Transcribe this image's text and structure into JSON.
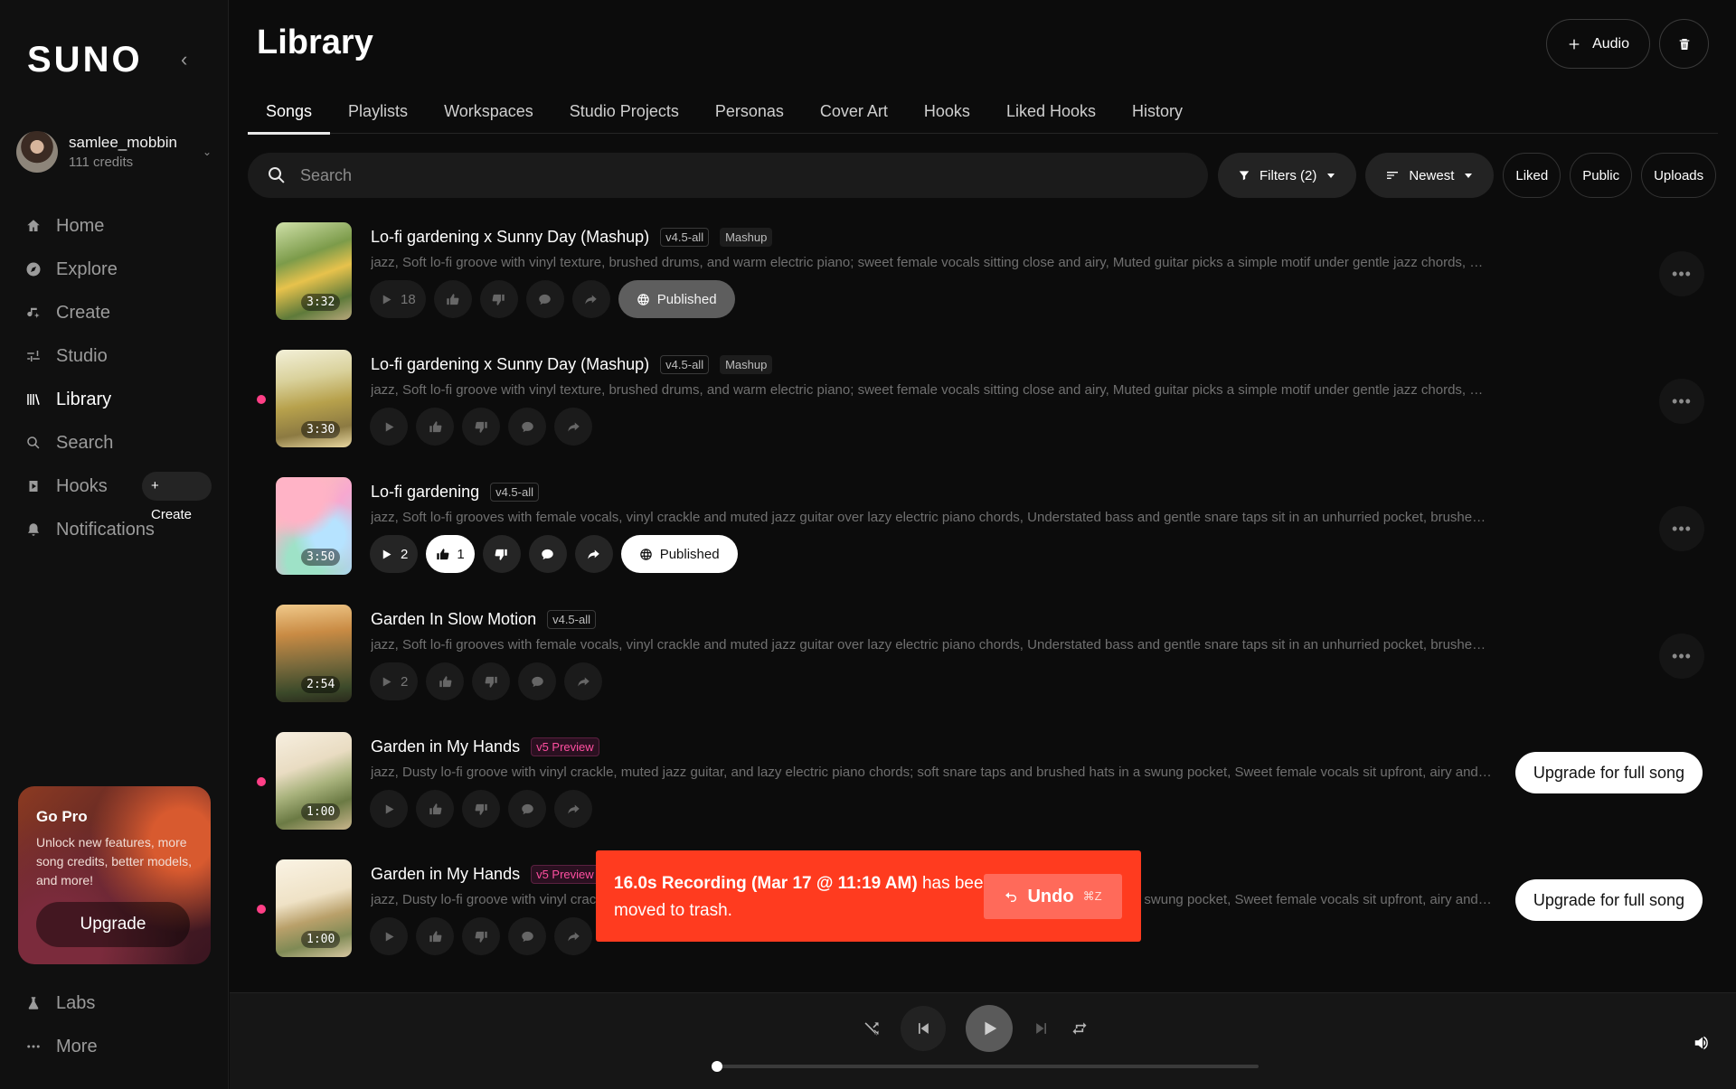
{
  "brand": "SUNO",
  "user": {
    "name": "samlee_mobbin",
    "credits": "111 credits"
  },
  "nav": {
    "items": [
      {
        "label": "Home",
        "icon": "home-icon"
      },
      {
        "label": "Explore",
        "icon": "compass-icon"
      },
      {
        "label": "Create",
        "icon": "music-note-icon"
      },
      {
        "label": "Studio",
        "icon": "sliders-icon"
      },
      {
        "label": "Library",
        "icon": "library-icon",
        "active": true
      },
      {
        "label": "Search",
        "icon": "search-icon"
      },
      {
        "label": "Hooks",
        "icon": "hook-icon"
      },
      {
        "label": "Notifications",
        "icon": "bell-icon"
      }
    ],
    "hooks_create": "+ Create",
    "bottom": [
      {
        "label": "Labs",
        "icon": "flask-icon"
      },
      {
        "label": "More",
        "icon": "ellipsis-icon"
      }
    ]
  },
  "gopro": {
    "title": "Go Pro",
    "text": "Unlock new features, more song credits, better models, and more!",
    "button": "Upgrade"
  },
  "page": {
    "title": "Library",
    "audio_button": "Audio"
  },
  "tabs": [
    "Songs",
    "Playlists",
    "Workspaces",
    "Studio Projects",
    "Personas",
    "Cover Art",
    "Hooks",
    "Liked Hooks",
    "History"
  ],
  "search": {
    "placeholder": "Search"
  },
  "filters": {
    "filters_label": "Filters (2)",
    "sort_label": "Newest",
    "liked": "Liked",
    "public": "Public",
    "uploads": "Uploads"
  },
  "songs": [
    {
      "title": "Lo-fi gardening x Sunny Day (Mashup)",
      "version": "v4.5-all",
      "badge": "Mashup",
      "duration": "3:32",
      "desc": "jazz, Soft lo-fi groove with vinyl texture, brushed drums, and warm electric piano; sweet female vocals sitting close and airy, Muted guitar picks a simple motif under gentle jazz chords, Nature a...",
      "plays": "18",
      "likes": "",
      "published": "Published"
    },
    {
      "title": "Lo-fi gardening x Sunny Day (Mashup)",
      "version": "v4.5-all",
      "badge": "Mashup",
      "duration": "3:30",
      "desc": "jazz, Soft lo-fi groove with vinyl texture, brushed drums, and warm electric piano; sweet female vocals sitting close and airy, Muted guitar picks a simple motif under gentle jazz chords, Nature a..."
    },
    {
      "title": "Lo-fi gardening",
      "version": "v4.5-all",
      "duration": "3:50",
      "desc": "jazz, Soft lo-fi grooves with female vocals, vinyl crackle and muted jazz guitar over lazy electric piano chords, Understated bass and gentle snare taps sit in an unhurried pocket, brushed hats s...",
      "plays": "2",
      "likes": "1",
      "published": "Published"
    },
    {
      "title": "Garden In Slow Motion",
      "version": "v4.5-all",
      "duration": "2:54",
      "desc": "jazz, Soft lo-fi grooves with female vocals, vinyl crackle and muted jazz guitar over lazy electric piano chords, Understated bass and gentle snare taps sit in an unhurried pocket, brushed hats s...",
      "plays": "2"
    },
    {
      "title": "Garden in My Hands",
      "version": "v5 Preview",
      "duration": "1:00",
      "desc": "jazz, Dusty lo-fi groove with vinyl crackle, muted jazz guitar, and lazy electric piano chords; soft snare taps and brushed hats in a swung pocket, Sweet female vocals sit upfront, airy and intimate, ...",
      "upgrade": "Upgrade for full song"
    },
    {
      "title": "Garden in My Hands",
      "version": "v5 Preview",
      "duration": "1:00",
      "desc": "jazz, Dusty lo-fi groove with vinyl crackle, muted jazz guitar, and lazy electric piano chords; soft snare taps and brushed hats in a swung pocket, Sweet female vocals sit upfront, airy and intimate, ...",
      "upgrade": "Upgrade for full song"
    }
  ],
  "toast": {
    "bold": "16.0s Recording (Mar 17 @ 11:19 AM)",
    "rest": " has been moved to trash.",
    "undo": "Undo",
    "shortcut": "⌘Z"
  },
  "colors": {
    "toast_bg": "#ff3b1f",
    "new_dot": "#ff3f86",
    "v5_badge": "#ff4fa0"
  }
}
